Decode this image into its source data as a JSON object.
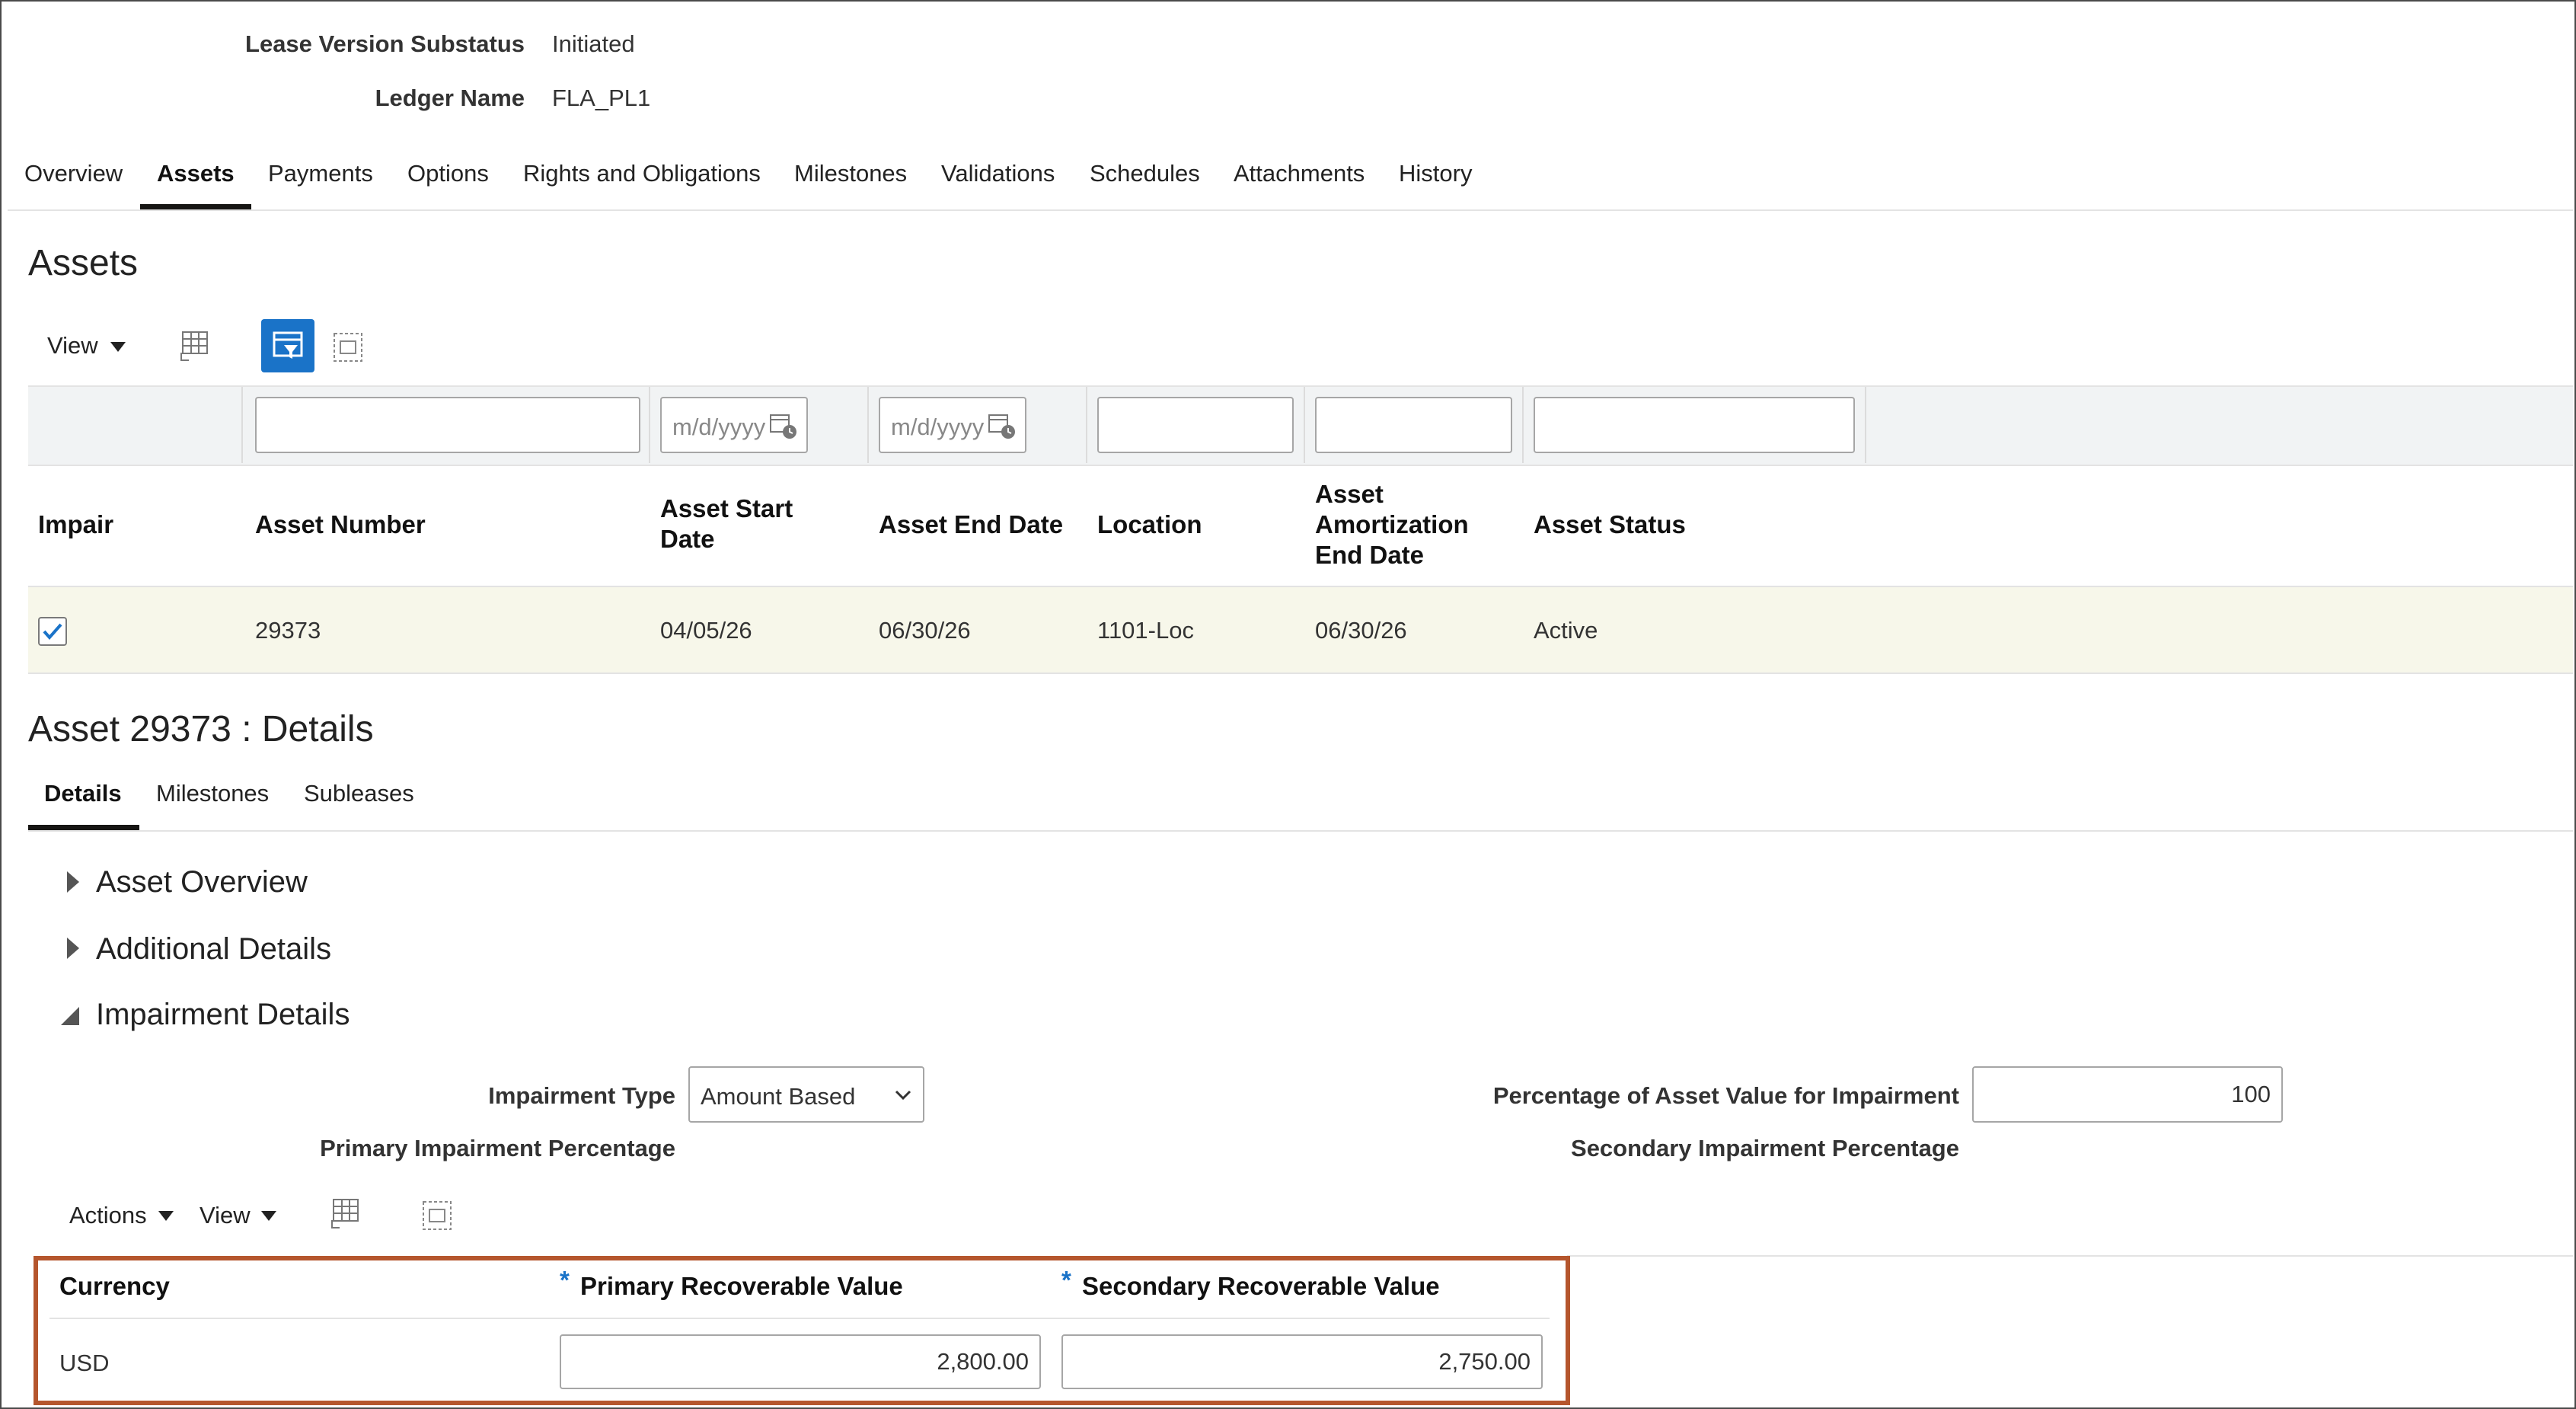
{
  "header": {
    "substatus_label": "Lease Version Substatus",
    "substatus_value": "Initiated",
    "ledger_label": "Ledger Name",
    "ledger_value": "FLA_PL1"
  },
  "tabs": [
    {
      "label": "Overview"
    },
    {
      "label": "Assets",
      "selected": true
    },
    {
      "label": "Payments"
    },
    {
      "label": "Options"
    },
    {
      "label": "Rights and Obligations"
    },
    {
      "label": "Milestones"
    },
    {
      "label": "Validations"
    },
    {
      "label": "Schedules"
    },
    {
      "label": "Attachments"
    },
    {
      "label": "History"
    }
  ],
  "assets": {
    "title": "Assets",
    "view_label": "View",
    "date_placeholder": "m/d/yyyy",
    "columns": {
      "impair": "Impair",
      "asset_number": "Asset Number",
      "start_date": [
        "Asset Start",
        "Date"
      ],
      "end_date": "Asset End Date",
      "location": "Location",
      "amort_end": [
        "Asset",
        "Amortization",
        "End Date"
      ],
      "status": "Asset Status"
    },
    "rows": [
      {
        "impair": true,
        "asset_number": "29373",
        "start_date": "04/05/26",
        "end_date": "06/30/26",
        "location": "1101-Loc",
        "amort_end": "06/30/26",
        "status": "Active"
      }
    ]
  },
  "details": {
    "title": "Asset 29373 : Details",
    "subtabs": [
      {
        "label": "Details",
        "selected": true
      },
      {
        "label": "Milestones"
      },
      {
        "label": "Subleases"
      }
    ],
    "sections": {
      "asset_overview": "Asset Overview",
      "additional_details": "Additional Details",
      "impairment_details": "Impairment Details"
    },
    "impairment": {
      "type_label": "Impairment Type",
      "type_value": "Amount Based",
      "primary_pct_label": "Primary Impairment Percentage",
      "pct_asset_label": "Percentage of Asset Value for Impairment",
      "pct_asset_value": "100",
      "secondary_pct_label": "Secondary Impairment Percentage"
    },
    "toolbar": {
      "actions_label": "Actions",
      "view_label": "View"
    },
    "table": {
      "currency_header": "Currency",
      "required_mark": "*",
      "primary_header": "Primary Recoverable Value",
      "secondary_header": "Secondary Recoverable Value",
      "rows": [
        {
          "currency": "USD",
          "primary": "2,800.00",
          "secondary": "2,750.00"
        }
      ]
    }
  },
  "colors": {
    "highlight_border": "#b5562d",
    "selected_row": "#f7f7ea",
    "filter_bar": "#f1f3f4",
    "accent_blue": "#1a73c8"
  }
}
